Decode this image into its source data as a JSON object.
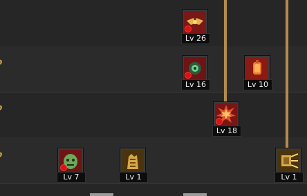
{
  "skills": [
    {
      "id": "skill-a",
      "level_label": "Lv 26",
      "icon": "golden-winged-emblem",
      "frame": "red"
    },
    {
      "id": "skill-b",
      "level_label": "Lv 16",
      "icon": "green-gear-orb",
      "frame": "red"
    },
    {
      "id": "skill-c",
      "level_label": "Lv 10",
      "icon": "orange-lantern",
      "frame": "red"
    },
    {
      "id": "skill-d",
      "level_label": "Lv 18",
      "icon": "explosion-burst",
      "frame": "red"
    },
    {
      "id": "skill-e",
      "level_label": "Lv 7",
      "icon": "green-beast-head",
      "frame": "red"
    },
    {
      "id": "skill-f",
      "level_label": "Lv 1",
      "icon": "golden-totem",
      "frame": "gold"
    },
    {
      "id": "skill-g",
      "level_label": "Lv 1",
      "icon": "golden-shield-blast",
      "frame": "gold"
    }
  ],
  "colors": {
    "connector": "#b48a4e",
    "row_marker": "#c89a40",
    "frame_red": "#6e1414",
    "frame_gold": "#5a4214",
    "warning_dot": "#dd1111"
  }
}
